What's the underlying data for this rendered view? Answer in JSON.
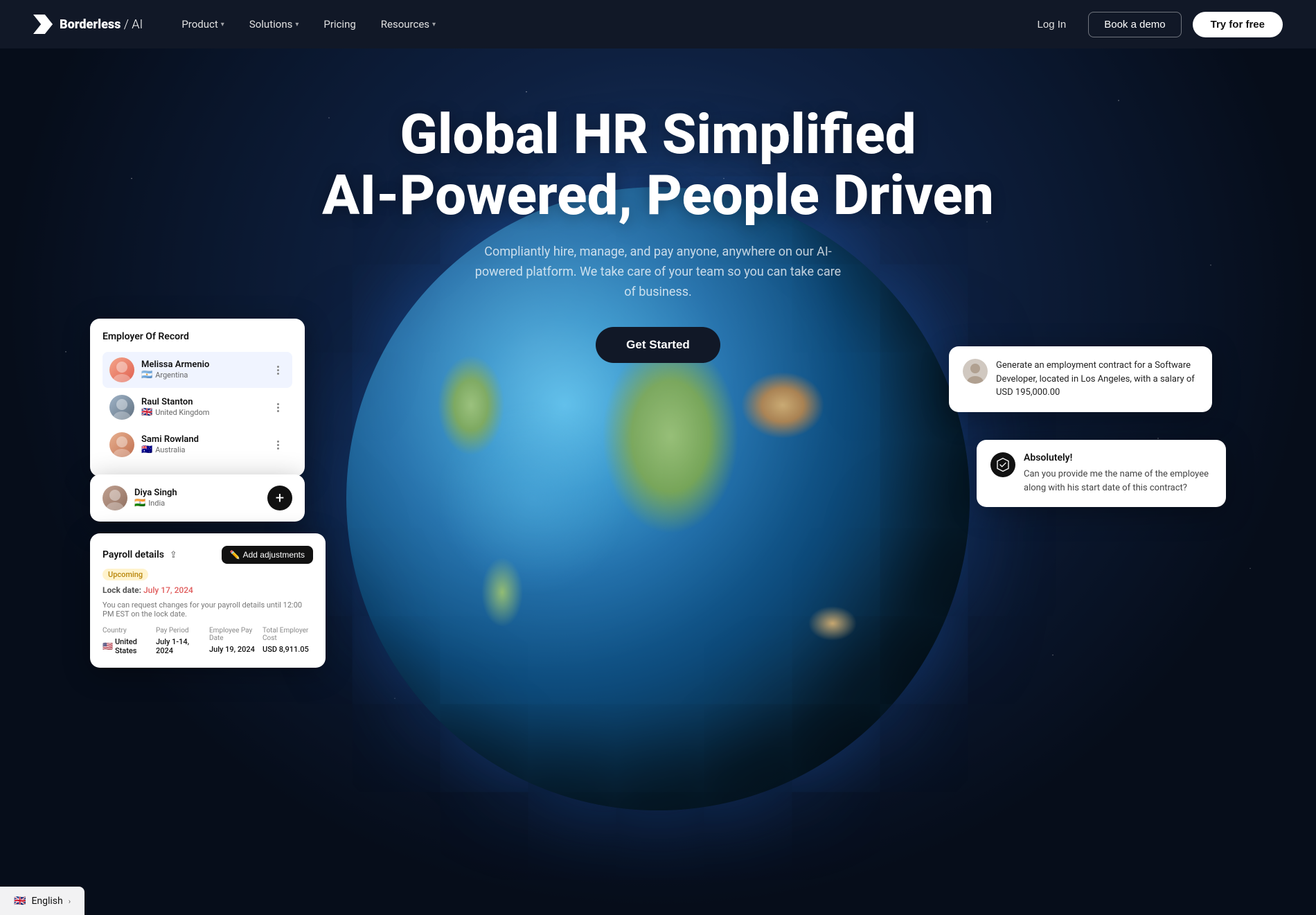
{
  "navbar": {
    "logo": {
      "name": "Borderless / AI",
      "name_bold": "Borderless",
      "name_separator": " / ",
      "name_light": "AI"
    },
    "links": [
      {
        "label": "Product",
        "has_dropdown": true
      },
      {
        "label": "Solutions",
        "has_dropdown": true
      },
      {
        "label": "Pricing",
        "has_dropdown": false
      },
      {
        "label": "Resources",
        "has_dropdown": true
      }
    ],
    "login_label": "Log In",
    "demo_label": "Book a demo",
    "try_label": "Try for free"
  },
  "hero": {
    "title_line1": "Global HR Simplified",
    "title_line2": "AI-Powered, People Driven",
    "subtitle": "Compliantly hire, manage, and pay anyone, anywhere on our AI-powered platform. We take care of your team so you can take care of business.",
    "cta_label": "Get Started"
  },
  "employer_card": {
    "title": "Employer Of Record",
    "employees": [
      {
        "name": "Melissa Armenio",
        "country": "Argentina",
        "flag": "🇦🇷",
        "highlighted": true
      },
      {
        "name": "Raul Stanton",
        "country": "United Kingdom",
        "flag": "🇬🇧",
        "highlighted": false
      },
      {
        "name": "Sami Rowland",
        "country": "Australia",
        "flag": "🇦🇺",
        "highlighted": false
      }
    ]
  },
  "diya_card": {
    "name": "Diya Singh",
    "country": "India",
    "flag": "🇮🇳",
    "add_label": "+"
  },
  "payroll_card": {
    "title": "Payroll details",
    "status": "Upcoming",
    "add_label": "Add adjustments",
    "lock_label": "Lock date:",
    "lock_date": "July 17, 2024",
    "lock_desc": "You can request changes for your payroll details until 12:00 PM EST on the lock date.",
    "table_headers": [
      "Country",
      "Pay Period",
      "Employee Pay Date",
      "Total Employer Cost"
    ],
    "table_values": {
      "country_flag": "🇺🇸",
      "country_name": "United States",
      "pay_period": "July 1-14, 2024",
      "pay_date": "July 19, 2024",
      "total_cost": "USD 8,911.05"
    }
  },
  "ai_prompt_card": {
    "text": "Generate an employment contract for a Software Developer, located in Los Angeles, with a salary of USD 195,000.00"
  },
  "ai_response_card": {
    "heading": "Absolutely!",
    "body": "Can you provide me the name of the employee along with his start date of this contract?"
  },
  "language_footer": {
    "flag": "🇬🇧",
    "label": "English",
    "chevron": "›"
  }
}
